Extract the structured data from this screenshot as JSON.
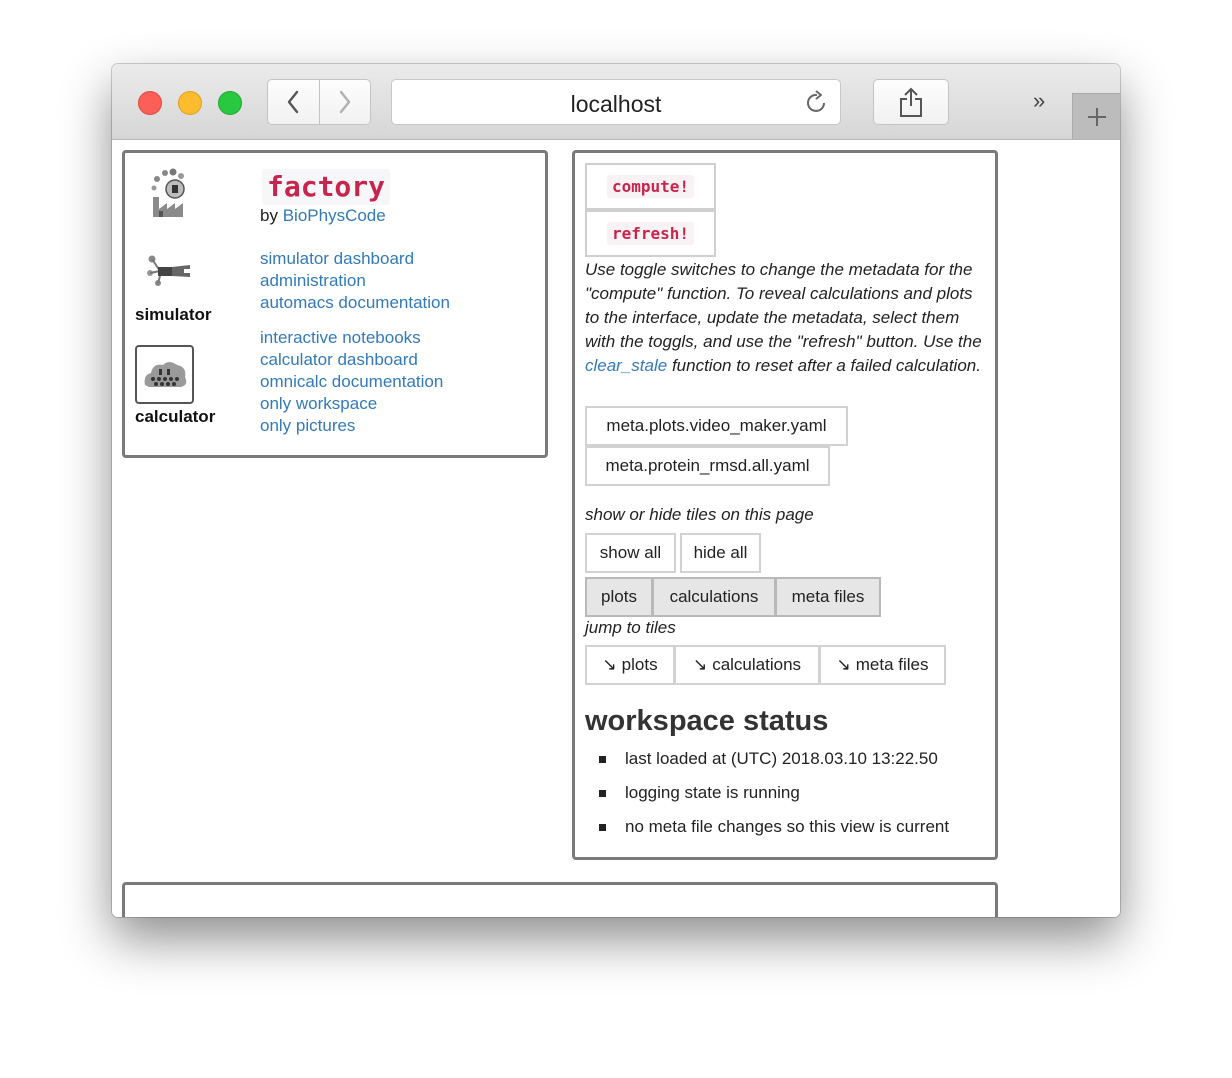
{
  "browser": {
    "url": "localhost",
    "more_glyph": "»",
    "new_tab_glyph": "+"
  },
  "sidebar": {
    "brand": "factory",
    "by_prefix": "by",
    "author": "BioPhysCode",
    "simulator_label": "simulator",
    "calculator_label": "calculator",
    "simulator_links": [
      "simulator dashboard",
      "administration",
      "automacs documentation"
    ],
    "calculator_links": [
      "interactive notebooks",
      "calculator dashboard",
      "omnicalc documentation",
      "only workspace",
      "only pictures"
    ]
  },
  "controls": {
    "compute_label": "compute!",
    "refresh_label": "refresh!",
    "description_1": "Use toggle switches to change the metadata for the \"compute\" function. To reveal calculations and plots to the interface, update the metadata, select them with the toggls, and use the \"refresh\" button. Use the ",
    "description_link": "clear_stale",
    "description_2": " function to reset after a failed calculation.",
    "meta_files": [
      "meta.plots.video_maker.yaml",
      "meta.protein_rmsd.all.yaml"
    ],
    "show_hide_label": "show or hide tiles on this page",
    "show_all_label": "show all",
    "hide_all_label": "hide all",
    "tile_toggles": [
      "plots",
      "calculations",
      "meta files"
    ],
    "jump_label": "jump to tiles",
    "jump_arrow": "↘",
    "jump_buttons": [
      "plots",
      "calculations",
      "meta files"
    ]
  },
  "status": {
    "title": "workspace status",
    "items": [
      "last loaded at (UTC) 2018.03.10 13:22.50",
      "logging state is running",
      "no meta file changes so this view is current"
    ]
  }
}
